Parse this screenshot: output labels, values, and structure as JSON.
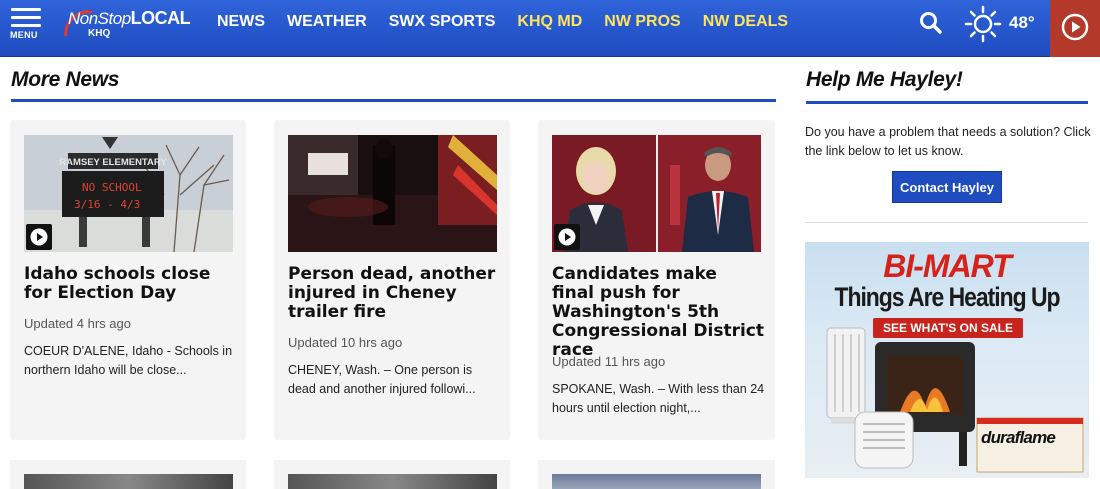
{
  "header": {
    "menu_label": "MENU",
    "logo_line1_a": "NonStop",
    "logo_line1_b": "LOCAL",
    "logo_line2": "KHQ",
    "nav": [
      {
        "label": "NEWS",
        "accent": false
      },
      {
        "label": "WEATHER",
        "accent": false
      },
      {
        "label": "SWX SPORTS",
        "accent": false
      },
      {
        "label": "KHQ MD",
        "accent": true
      },
      {
        "label": "NW PROS",
        "accent": true
      },
      {
        "label": "NW DEALS",
        "accent": true
      }
    ],
    "temperature": "48°",
    "weather_icon": "sun-icon",
    "search_icon": "search-icon",
    "live_icon": "play-circle-icon",
    "colors": {
      "bar": "#1f4cc0",
      "accent": "#ffe45c",
      "live": "#b33a2a"
    }
  },
  "more_news": {
    "title": "More News",
    "cards": [
      {
        "headline": "Idaho schools close for Election Day",
        "updated": "Updated 4 hrs ago",
        "summary": "COEUR D'ALENE, Idaho - Schools in northern Idaho will be close...",
        "has_video": true,
        "sign_name": "RAMSEY ELEMENTARY",
        "sign_text_1": "NO SCHOOL",
        "sign_text_2": "3/16 - 4/3"
      },
      {
        "headline": "Person dead, another injured in Cheney trailer fire",
        "updated": "Updated 10 hrs ago",
        "summary": "CHENEY, Wash. – One person is dead and another injured followi...",
        "has_video": false
      },
      {
        "headline": "Candidates make final push for Washington's 5th Congressional District race",
        "updated": "Updated 11 hrs ago",
        "summary": "SPOKANE, Wash. – With less than 24 hours until election night,...",
        "has_video": true
      }
    ]
  },
  "help_me_hayley": {
    "title": "Help Me Hayley!",
    "text": "Do you have a problem that needs a solution? Click the link below to let us know.",
    "button": "Contact Hayley"
  },
  "ad": {
    "brand": "BI-MART",
    "tagline": "Things Are Heating Up",
    "cta": "SEE WHAT'S ON SALE",
    "product": "duraflame"
  }
}
